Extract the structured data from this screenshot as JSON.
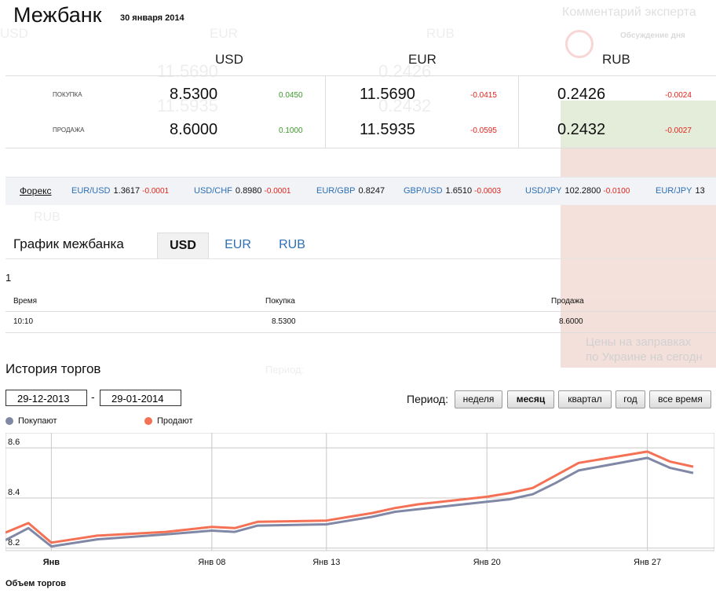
{
  "header": {
    "title": "Межбанк",
    "date": "30 января 2014"
  },
  "expert": {
    "title": "Комментарий эксперта",
    "discussion": "Обсуждение дня",
    "banner_text_1": "Цены на заправках",
    "banner_text_2": "по Украине на сегодн"
  },
  "rates": {
    "currencies": [
      "USD",
      "EUR",
      "RUB"
    ],
    "buy_label": "ПОКУПКА",
    "sell_label": "ПРОДАЖА",
    "buy": [
      {
        "value": "8.5300",
        "change": "0.0450"
      },
      {
        "value": "11.5690",
        "change": "-0.0415"
      },
      {
        "value": "0.2426",
        "change": "-0.0024"
      }
    ],
    "sell": [
      {
        "value": "8.6000",
        "change": "0.1000"
      },
      {
        "value": "11.5935",
        "change": "-0.0595"
      },
      {
        "value": "0.2432",
        "change": "-0.0027"
      }
    ]
  },
  "forex": {
    "label": "Форекс",
    "pairs": [
      {
        "name": "EUR/USD",
        "price": "1.3617",
        "change": "-0.0001"
      },
      {
        "name": "USD/CHF",
        "price": "0.8980",
        "change": "-0.0001"
      },
      {
        "name": "EUR/GBP",
        "price": "0.8247",
        "change": ""
      },
      {
        "name": "GBP/USD",
        "price": "1.6510",
        "change": "-0.0003"
      },
      {
        "name": "USD/JPY",
        "price": "102.2800",
        "change": "-0.0100"
      },
      {
        "name": "EUR/JPY",
        "price": "13",
        "change": ""
      }
    ]
  },
  "interbank_chart": {
    "title": "График межбанка",
    "tabs": [
      "USD",
      "EUR",
      "RUB"
    ],
    "active_tab": "USD",
    "count": "1",
    "table": {
      "headers": [
        "Время",
        "Покупка",
        "Продажа"
      ],
      "rows": [
        [
          "10:10",
          "8.5300",
          "8.6000"
        ]
      ]
    }
  },
  "history": {
    "title": "История торгов",
    "date_from": "29-12-2013",
    "date_to": "29-01-2014",
    "dash": "-",
    "period_label": "Период:",
    "periods": [
      "неделя",
      "месяц",
      "квартал",
      "год",
      "все время"
    ],
    "active_period": "месяц",
    "legend_buy": "Покупают",
    "legend_sell": "Продают",
    "volume_title": "Объем торгов"
  },
  "colors": {
    "buy": "#8088a6",
    "sell": "#f47155",
    "link": "#2e6fb5",
    "negative": "#e2231a",
    "positive": "#3a9a2a"
  },
  "chart_data": {
    "type": "line",
    "x": [
      "2013-12-30",
      "2013-12-31",
      "2014-01-01",
      "2014-01-03",
      "2014-01-06",
      "2014-01-08",
      "2014-01-09",
      "2014-01-10",
      "2014-01-13",
      "2014-01-14",
      "2014-01-15",
      "2014-01-16",
      "2014-01-17",
      "2014-01-20",
      "2014-01-21",
      "2014-01-22",
      "2014-01-23",
      "2014-01-24",
      "2014-01-27",
      "2014-01-28",
      "2014-01-29"
    ],
    "series": [
      {
        "name": "Покупают",
        "values": [
          8.232,
          8.28,
          8.207,
          8.235,
          8.255,
          8.27,
          8.265,
          8.29,
          8.295,
          8.31,
          8.325,
          8.345,
          8.355,
          8.385,
          8.395,
          8.415,
          8.46,
          8.51,
          8.56,
          8.52,
          8.5
        ]
      },
      {
        "name": "Продают",
        "values": [
          8.262,
          8.3,
          8.222,
          8.25,
          8.265,
          8.285,
          8.28,
          8.305,
          8.31,
          8.325,
          8.34,
          8.36,
          8.375,
          8.405,
          8.42,
          8.44,
          8.49,
          8.54,
          8.585,
          8.545,
          8.525
        ]
      }
    ],
    "ytick_labels": [
      "8.2",
      "8.4",
      "8.6"
    ],
    "xtick_labels": [
      "Янв",
      "Янв 08",
      "Янв 13",
      "Янв 20",
      "Янв 27"
    ],
    "ylim": [
      8.19,
      8.66
    ],
    "grid": true,
    "legend": "top-left"
  }
}
